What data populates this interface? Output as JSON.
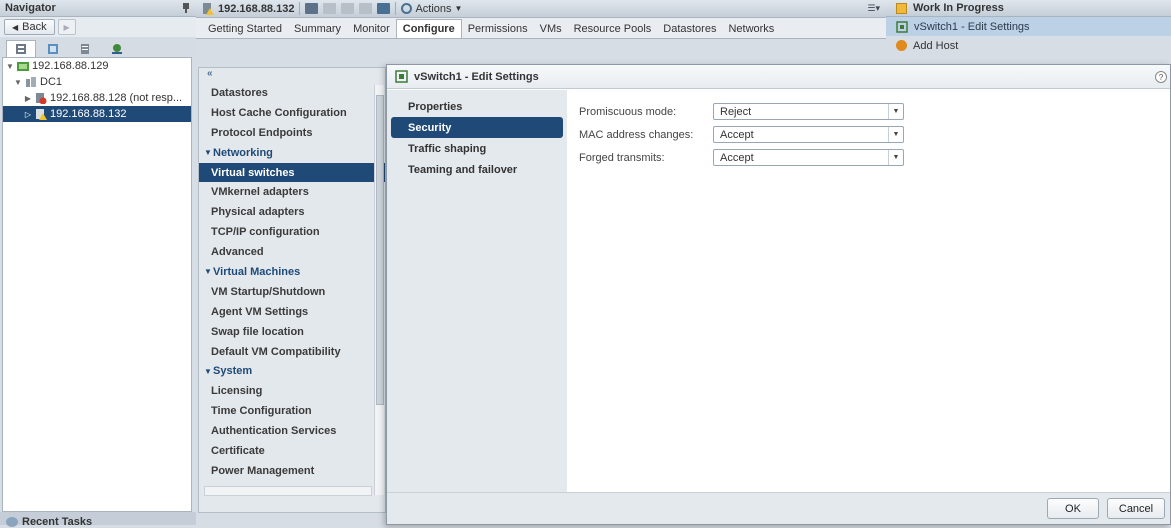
{
  "navigator": {
    "title": "Navigator",
    "back_label": "Back",
    "tree": [
      {
        "label": "192.168.88.129",
        "depth": 0,
        "expanded": true,
        "icon": "vcenter-icon"
      },
      {
        "label": "DC1",
        "depth": 1,
        "expanded": true,
        "icon": "datacenter-icon"
      },
      {
        "label": "192.168.88.128 (not resp...",
        "depth": 2,
        "expanded": false,
        "icon": "host-error-icon"
      },
      {
        "label": "192.168.88.132",
        "depth": 2,
        "expanded": false,
        "icon": "host-warning-icon",
        "selected": true
      }
    ],
    "recent_tasks": "Recent Tasks"
  },
  "main": {
    "host": "192.168.88.132",
    "actions_label": "Actions",
    "tabs": [
      "Getting Started",
      "Summary",
      "Monitor",
      "Configure",
      "Permissions",
      "VMs",
      "Resource Pools",
      "Datastores",
      "Networks"
    ],
    "active_tab": "Configure",
    "collapse_glyph": "«",
    "config_items": [
      {
        "type": "item",
        "label": "Datastores"
      },
      {
        "type": "item",
        "label": "Host Cache Configuration"
      },
      {
        "type": "item",
        "label": "Protocol Endpoints"
      },
      {
        "type": "group",
        "label": "Networking"
      },
      {
        "type": "item",
        "label": "Virtual switches",
        "active": true
      },
      {
        "type": "item",
        "label": "VMkernel adapters"
      },
      {
        "type": "item",
        "label": "Physical adapters"
      },
      {
        "type": "item",
        "label": "TCP/IP configuration"
      },
      {
        "type": "item",
        "label": "Advanced"
      },
      {
        "type": "group",
        "label": "Virtual Machines"
      },
      {
        "type": "item",
        "label": "VM Startup/Shutdown"
      },
      {
        "type": "item",
        "label": "Agent VM Settings"
      },
      {
        "type": "item",
        "label": "Swap file location"
      },
      {
        "type": "item",
        "label": "Default VM Compatibility"
      },
      {
        "type": "group",
        "label": "System"
      },
      {
        "type": "item",
        "label": "Licensing"
      },
      {
        "type": "item",
        "label": "Time Configuration"
      },
      {
        "type": "item",
        "label": "Authentication Services"
      },
      {
        "type": "item",
        "label": "Certificate"
      },
      {
        "type": "item",
        "label": "Power Management"
      }
    ]
  },
  "work_in_progress": {
    "title": "Work In Progress",
    "items": [
      {
        "label": "vSwitch1 - Edit Settings",
        "selected": true
      },
      {
        "label": "Add Host",
        "selected": false
      }
    ]
  },
  "dialog": {
    "title": "vSwitch1 - Edit Settings",
    "help": "?",
    "nav": [
      "Properties",
      "Security",
      "Traffic shaping",
      "Teaming and failover"
    ],
    "active_nav": "Security",
    "fields": [
      {
        "label": "Promiscuous mode:",
        "value": "Reject"
      },
      {
        "label": "MAC address changes:",
        "value": "Accept"
      },
      {
        "label": "Forged transmits:",
        "value": "Accept"
      }
    ],
    "ok_label": "OK",
    "cancel_label": "Cancel"
  },
  "colors": {
    "selection": "#1f4a77",
    "wip_selection": "#bcd1e6",
    "panel": "#e4e9ee"
  }
}
